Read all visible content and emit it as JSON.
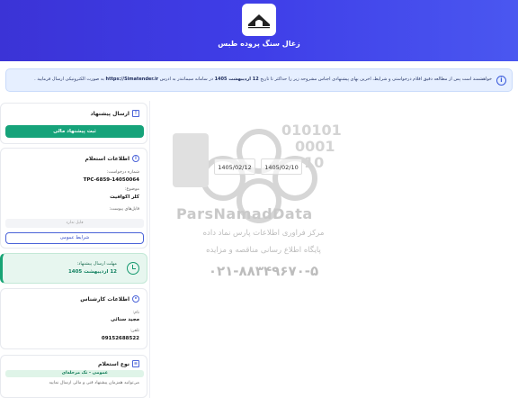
{
  "header": {
    "title": "زغال سنگ پروده طبس"
  },
  "notice": {
    "prefix": "خواهشمند است پس از مطالعه دقیق اقلام درخواستی و شرایط، آخرین بهای پیشنهادی اجناس مشروحه زیر را حداکثر تا تاریخ",
    "deadline": "12 اردیبهشت 1405",
    "middle": "در سامانه سیماتندر به آدرس",
    "url": "https://Simatender.ir",
    "suffix": "به صورت الکترونیکی ارسال فرمایید ."
  },
  "send_offer": {
    "title": "ارسال پیشنهاد",
    "button": "ثبت پیشنهاد مالی"
  },
  "inquiry_info": {
    "title": "اطلاعات استعلام",
    "request_number_label": "شماره درخواست:",
    "request_number": "TPC-6859-14050064",
    "subject_label": "موضوع:",
    "subject": "کلر اکوافیت",
    "attachments_label": "فایل‌های پیوست:",
    "no_file": "فایل ندارد",
    "terms_button": "شرایط عمومی"
  },
  "deadline": {
    "label": "مهلت ارسال پیشنهاد:",
    "value": "12 اردیبهشت 1405"
  },
  "expert": {
    "title": "اطلاعات کارشناس",
    "name_label": "نام:",
    "name": "مجید سنائی",
    "phone_label": "تلفن:",
    "phone": "09152688522"
  },
  "inquiry_type": {
    "title": "نوع استعلام",
    "value": "عمومی - تک مرحله‌ای",
    "note": "می‌توانید همزمان پیشنهاد فنی و مالی ارسال نمایید"
  },
  "watermark": {
    "date1": "1405/02/12",
    "date2": "1405/02/10",
    "brand": "ParsNamadData",
    "line1": "مرکز فراوری اطلاعات پارس نماد داده",
    "line2": "پایگاه اطلاع رسانی مناقصه و مزایده",
    "phone": "۰۲۱-۸۸۳۴۹۶۷۰-۵"
  },
  "colors": {
    "header": "#3f3ee8",
    "accent_green": "#16a37a",
    "accent_blue": "#4a63d8"
  }
}
